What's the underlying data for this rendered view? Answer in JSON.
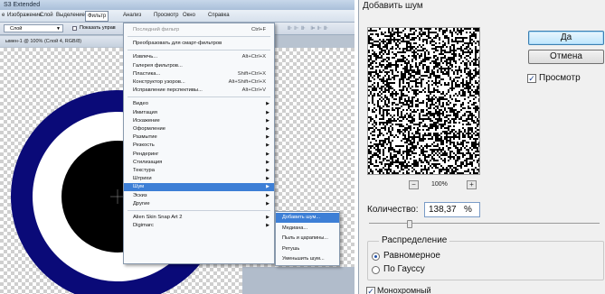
{
  "photoshop": {
    "title": "S3 Extended",
    "menubar": [
      {
        "label": "е",
        "active": false
      },
      {
        "label": "Изображение",
        "active": false
      },
      {
        "label": "Слой",
        "active": false
      },
      {
        "label": "Выделение",
        "active": false
      },
      {
        "label": "Фильтр",
        "active": true
      },
      {
        "label": "Анализ",
        "active": false
      },
      {
        "label": "Просмотр",
        "active": false
      },
      {
        "label": "Окно",
        "active": false
      },
      {
        "label": "Справка",
        "active": false
      }
    ],
    "options": {
      "tool_select": "Слой",
      "show_controls_label": "Показать управ"
    },
    "doc_tab": "ымен-1 @ 100% (Слой 4, RGB/8)",
    "colors": {
      "ring_outer": "#0a0a78",
      "ring_inner": "#ffffff",
      "core": "#000000",
      "highlight": "#3d7fd6"
    }
  },
  "filter_menu": {
    "items": [
      {
        "label": "Последний фильтр",
        "shortcut": "Ctrl+F",
        "disabled": true
      },
      {
        "separator": true
      },
      {
        "label": "Преобразовать для смарт-фильтров"
      },
      {
        "separator": true
      },
      {
        "label": "Извлечь...",
        "shortcut": "Alt+Ctrl+X"
      },
      {
        "label": "Галерея фильтров..."
      },
      {
        "label": "Пластика...",
        "shortcut": "Shift+Ctrl+X"
      },
      {
        "label": "Конструктор узоров...",
        "shortcut": "Alt+Shift+Ctrl+X"
      },
      {
        "label": "Исправление перспективы...",
        "shortcut": "Alt+Ctrl+V"
      },
      {
        "separator": true
      },
      {
        "label": "Видео",
        "submenu": true
      },
      {
        "label": "Имитация",
        "submenu": true
      },
      {
        "label": "Искажение",
        "submenu": true
      },
      {
        "label": "Оформление",
        "submenu": true
      },
      {
        "label": "Размытие",
        "submenu": true
      },
      {
        "label": "Резкость",
        "submenu": true
      },
      {
        "label": "Рендеринг",
        "submenu": true
      },
      {
        "label": "Стилизация",
        "submenu": true
      },
      {
        "label": "Текстура",
        "submenu": true
      },
      {
        "label": "Штрихи",
        "submenu": true
      },
      {
        "label": "Шум",
        "submenu": true,
        "highlighted": true
      },
      {
        "label": "Эскиз",
        "submenu": true
      },
      {
        "label": "Другие",
        "submenu": true
      },
      {
        "separator": true
      },
      {
        "label": "Alien Skin Snap Art 2",
        "submenu": true
      },
      {
        "label": "Digimarc",
        "submenu": true
      }
    ],
    "noise_submenu": [
      {
        "label": "Добавить шум...",
        "highlighted": true
      },
      {
        "label": "Медиана..."
      },
      {
        "label": "Пыль и царапины..."
      },
      {
        "label": "Ретушь"
      },
      {
        "label": "Уменьшить шум..."
      }
    ]
  },
  "dialog": {
    "title": "Добавить шум",
    "ok_label": "Да",
    "cancel_label": "Отмена",
    "preview_label": "Просмотр",
    "preview_checked": true,
    "zoom": "100%",
    "zoom_minus": "−",
    "zoom_plus": "+",
    "amount_label": "Количество:",
    "amount_value": "138,37",
    "amount_unit": "%",
    "amount_fraction": 0.35,
    "distribution_label": "Распределение",
    "uniform_label": "Равномерное",
    "gaussian_label": "По Гауссу",
    "distribution_selected": "uniform",
    "mono_label": "Монохромный",
    "mono_checked": true,
    "check_mark": "✓"
  }
}
